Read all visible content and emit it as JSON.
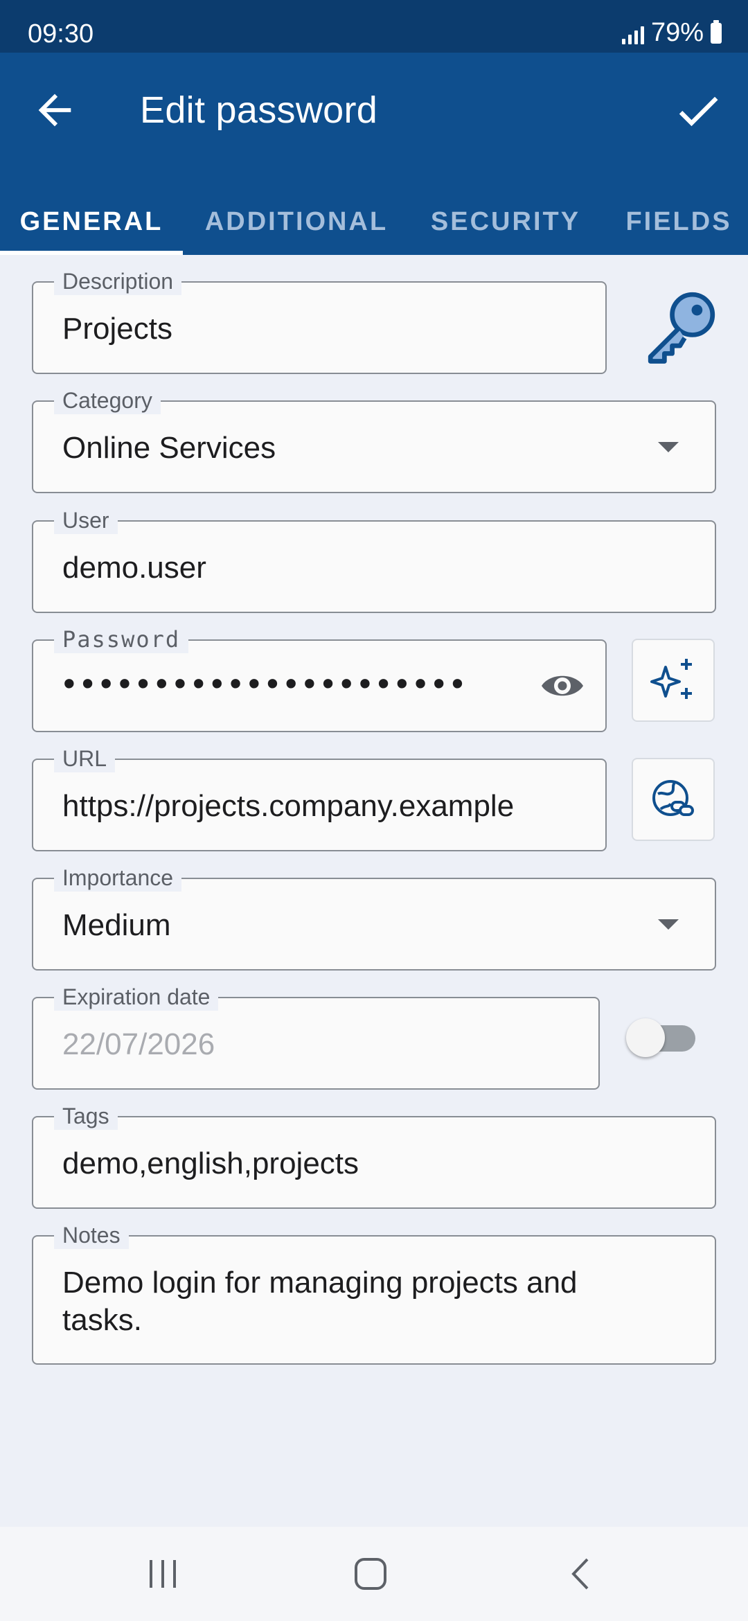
{
  "status_bar": {
    "time": "09:30",
    "battery": "79%"
  },
  "app_bar": {
    "title": "Edit password",
    "back_icon": "arrow-back-icon",
    "confirm_icon": "checkmark-icon"
  },
  "tabs": [
    {
      "label": "GENERAL",
      "active": true
    },
    {
      "label": "ADDITIONAL",
      "active": false
    },
    {
      "label": "SECURITY",
      "active": false
    },
    {
      "label": "FIELDS",
      "active": false
    }
  ],
  "form": {
    "description": {
      "label": "Description",
      "value": "Projects",
      "icon": "key-icon"
    },
    "category": {
      "label": "Category",
      "value": "Online Services"
    },
    "user": {
      "label": "User",
      "value": "demo.user"
    },
    "password": {
      "label": "Password",
      "value": "••••••••••••••••••••••",
      "visibility_icon": "eye-icon",
      "generate_icon": "sparkles-icon"
    },
    "url": {
      "label": "URL",
      "value": "https://projects.company.example",
      "open_icon": "globe-link-icon"
    },
    "importance": {
      "label": "Importance",
      "value": "Medium"
    },
    "expiration": {
      "label": "Expiration date",
      "value": "22/07/2026",
      "enabled": false
    },
    "tags": {
      "label": "Tags",
      "value": "demo,english,projects"
    },
    "notes": {
      "label": "Notes",
      "value_line1": "Demo login for managing projects and",
      "value_line2": "tasks."
    }
  },
  "colors": {
    "status_bar": "#0c3c6e",
    "app_bar": "#0f4f8e",
    "background": "#edf0f7",
    "tab_inactive": "#a4bedb",
    "icon_accent": "#0f4f8e"
  },
  "nav_bar": {
    "recents_icon": "recents-icon",
    "home_icon": "home-icon",
    "back_icon": "nav-back-icon"
  }
}
